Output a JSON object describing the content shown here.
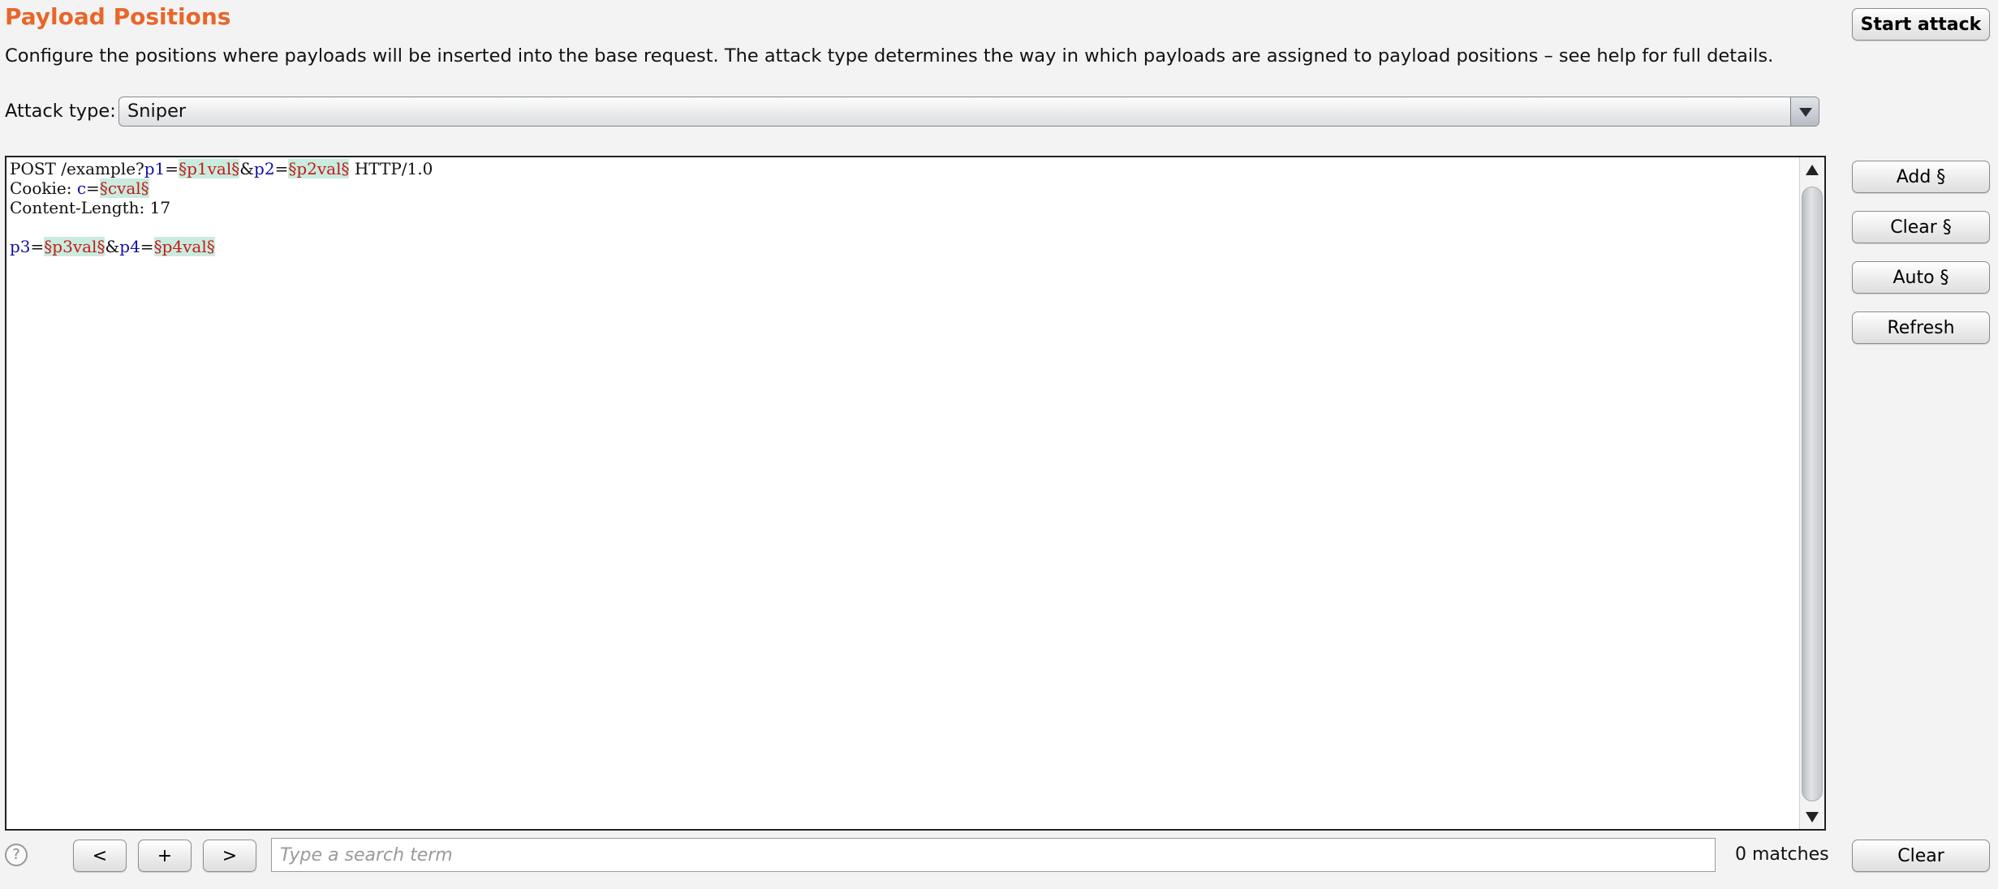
{
  "header": {
    "title": "Payload Positions",
    "description": "Configure the positions where payloads will be inserted into the base request. The attack type determines the way in which payloads are assigned to payload positions – see help for full details."
  },
  "attack": {
    "label": "Attack type:",
    "selected": "Sniper"
  },
  "buttons": {
    "start_attack": "Start attack",
    "add": "Add §",
    "clear_marks": "Clear §",
    "auto": "Auto §",
    "refresh": "Refresh"
  },
  "request": {
    "line1": {
      "pre": "POST /example?",
      "p1": "p1",
      "eq1": "=",
      "v1": "§p1val§",
      "amp": "&",
      "p2": "p2",
      "eq2": "=",
      "v2": "§p2val§",
      "post": " HTTP/1.0"
    },
    "line2": {
      "pre": "Cookie: ",
      "p": "c",
      "eq": "=",
      "v": "§cval§"
    },
    "line3": "Content-Length: 17",
    "line5": {
      "p3": "p3",
      "eq1": "=",
      "v3": "§p3val§",
      "amp": "&",
      "p4": "p4",
      "eq2": "=",
      "v4": "§p4val§"
    }
  },
  "search": {
    "prev": "<",
    "add": "+",
    "next": ">",
    "placeholder": "Type a search term",
    "matches": "0 matches",
    "clear": "Clear"
  },
  "icons": {
    "help": "?"
  },
  "colors": {
    "title": "#e8662a",
    "param_name": "#0e0ea8",
    "payload_text": "#c41a1a",
    "payload_bg": "#c9ecde"
  }
}
